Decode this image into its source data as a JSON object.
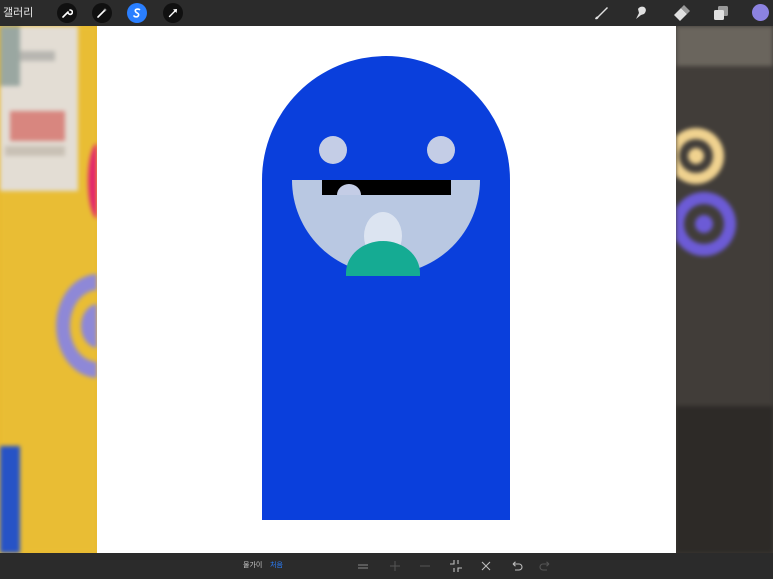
{
  "topbar": {
    "gallery_label": "갤러리",
    "left_tools": [
      "wrench-icon",
      "magic-wand-icon",
      "selection-icon",
      "transform-arrow-icon"
    ],
    "active_tool": "selection-icon",
    "right_tools": [
      "brush-icon",
      "smudge-icon",
      "eraser-icon",
      "layers-icon"
    ],
    "current_color": "#8c82e0"
  },
  "canvas": {
    "background": "#ffffff",
    "character": {
      "body_color": "#0a3fdc",
      "eye_color": "#c4cde6",
      "mouth_color": "#b9c8e2",
      "tongue_color": "#15ab93",
      "visor_color": "#000000"
    }
  },
  "bottombar": {
    "left_label": "물가이",
    "accent_label": "처음",
    "icons": [
      "flatten-icon",
      "plus-icon",
      "minus-icon",
      "fit-icon",
      "cancel-icon",
      "undo-icon",
      "redo-icon"
    ]
  }
}
